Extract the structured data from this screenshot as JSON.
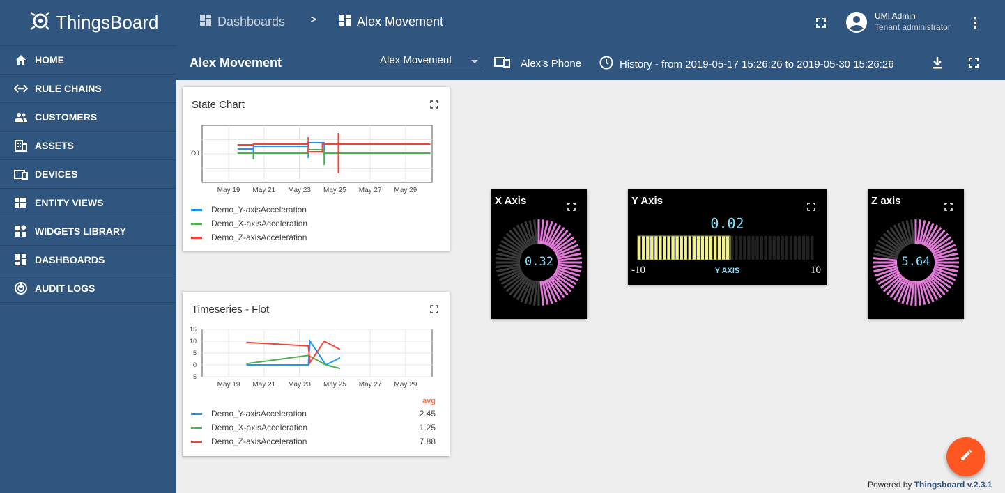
{
  "app": {
    "name": "ThingsBoard"
  },
  "sidebar": {
    "items": [
      {
        "label": "HOME",
        "icon": "home-icon"
      },
      {
        "label": "RULE CHAINS",
        "icon": "rule-chains-icon"
      },
      {
        "label": "CUSTOMERS",
        "icon": "customers-icon"
      },
      {
        "label": "ASSETS",
        "icon": "assets-icon"
      },
      {
        "label": "DEVICES",
        "icon": "devices-icon"
      },
      {
        "label": "ENTITY VIEWS",
        "icon": "entity-views-icon"
      },
      {
        "label": "WIDGETS LIBRARY",
        "icon": "widgets-library-icon"
      },
      {
        "label": "DASHBOARDS",
        "icon": "dashboards-icon"
      },
      {
        "label": "AUDIT LOGS",
        "icon": "audit-logs-icon"
      }
    ]
  },
  "header": {
    "breadcrumb": {
      "first": "Dashboards",
      "separator": ">",
      "current": "Alex Movement"
    },
    "user": {
      "name": "UMI Admin",
      "role": "Tenant administrator"
    }
  },
  "dashboard": {
    "title": "Alex Movement",
    "state_select": "Alex Movement",
    "entity": "Alex's Phone",
    "history": "History - from 2019-05-17 15:26:26 to 2019-05-30 15:26:26"
  },
  "widgets": {
    "state_chart": {
      "title": "State Chart",
      "legend": [
        "Demo_Y-axisAcceleration",
        "Demo_X-axisAcceleration",
        "Demo_Z-axisAcceleration"
      ]
    },
    "timeseries": {
      "title": "Timeseries - Flot",
      "avg_header": "avg",
      "legend": [
        {
          "name": "Demo_Y-axisAcceleration",
          "avg": "2.45"
        },
        {
          "name": "Demo_X-axisAcceleration",
          "avg": "1.25"
        },
        {
          "name": "Demo_Z-axisAcceleration",
          "avg": "7.88"
        }
      ]
    },
    "x_axis": {
      "title": "X Axis",
      "value": "0.32",
      "level": 0.5
    },
    "y_axis": {
      "title": "Y Axis",
      "value": "0.02",
      "min": "-10",
      "max": "10",
      "label": "Y AXIS"
    },
    "z_axis": {
      "title": "Z axis",
      "value": "5.64",
      "level": 0.78
    }
  },
  "footer": {
    "powered_prefix": "Powered by",
    "powered_brand": "Thingsboard v.2.3.1"
  },
  "colors": {
    "primary": "#305680",
    "accent": "#ff5722",
    "series_y": "#2196f3",
    "series_x": "#4caf50",
    "series_z": "#f44336",
    "gauge_xz": "#e17bd8",
    "gauge_y": "#f2f28c"
  },
  "chart_data": [
    {
      "type": "line",
      "title": "State Chart",
      "categories": [
        "May 19",
        "May 21",
        "May 23",
        "May 25",
        "May 27",
        "May 29"
      ],
      "y_tick_labels": [
        "Off"
      ],
      "series": [
        {
          "name": "Demo_Y-axisAcceleration"
        },
        {
          "name": "Demo_X-axisAcceleration"
        },
        {
          "name": "Demo_Z-axisAcceleration"
        }
      ]
    },
    {
      "type": "line",
      "title": "Timeseries - Flot",
      "categories": [
        "May 19",
        "May 21",
        "May 23",
        "May 25",
        "May 27",
        "May 29"
      ],
      "y_ticks": [
        15,
        10,
        5,
        0,
        -5
      ],
      "ylim": [
        -5,
        15
      ],
      "series": [
        {
          "name": "Demo_Y-axisAcceleration",
          "points": [
            [
              "May 20",
              0
            ],
            [
              "May 23.5",
              0
            ],
            [
              "May 23.6",
              10
            ],
            [
              "May 24.5",
              0
            ],
            [
              "May 25.3",
              3
            ]
          ]
        },
        {
          "name": "Demo_X-axisAcceleration",
          "points": [
            [
              "May 20",
              0.5
            ],
            [
              "May 23.5",
              4
            ],
            [
              "May 24.5",
              0
            ],
            [
              "May 25.3",
              -1.5
            ]
          ]
        },
        {
          "name": "Demo_Z-axisAcceleration",
          "points": [
            [
              "May 20",
              9.5
            ],
            [
              "May 23.5",
              8
            ],
            [
              "May 23.6",
              1
            ],
            [
              "May 24.4",
              10
            ],
            [
              "May 25.3",
              6.5
            ]
          ]
        }
      ]
    }
  ]
}
